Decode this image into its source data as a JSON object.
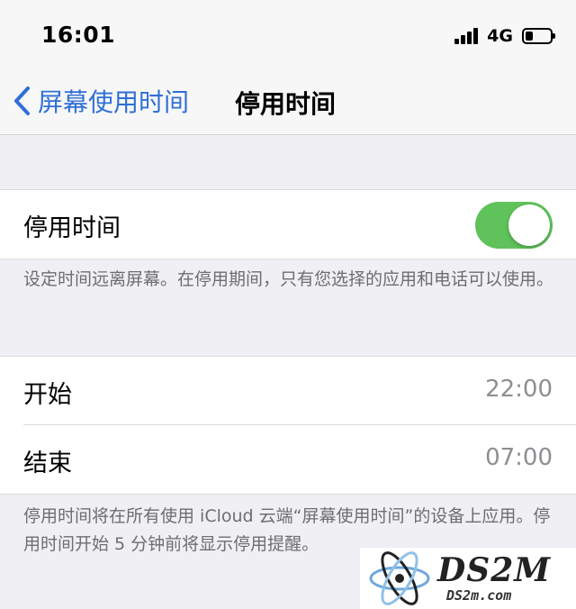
{
  "status_bar": {
    "time": "16:01",
    "network": "4G",
    "battery_level": 0.3
  },
  "nav": {
    "back_label": "屏幕使用时间",
    "title": "停用时间"
  },
  "downtime_toggle": {
    "label": "停用时间",
    "enabled": true
  },
  "downtime_description": "设定时间远离屏幕。在停用期间，只有您选择的应用和电话可以使用。",
  "schedule": [
    {
      "label": "开始",
      "value": "22:00"
    },
    {
      "label": "结束",
      "value": "07:00"
    }
  ],
  "schedule_footnote": "停用时间将在所有使用 iCloud 云端“屏幕使用时间”的设备上应用。停用时间开始 5 分钟前将显示停用提醒。",
  "watermark": {
    "main": "DS2M",
    "sub": "DS2m.com"
  },
  "colors": {
    "accent": "#2f6fd6",
    "toggle_on": "#5fc25a",
    "background": "#efeff4"
  }
}
